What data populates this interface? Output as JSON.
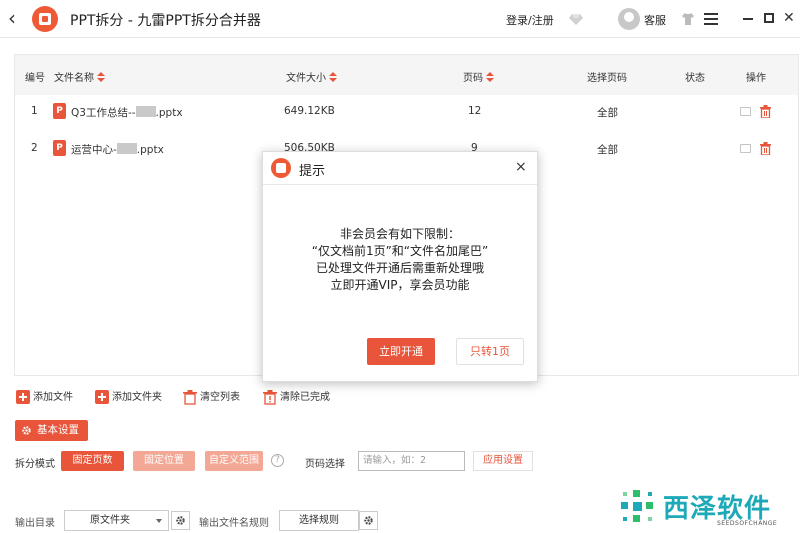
{
  "titlebar": {
    "title": "PPT拆分 - 九雷PPT拆分合并器",
    "login": "登录/注册",
    "service": "客服"
  },
  "table": {
    "headers": {
      "index": "编号",
      "name": "文件名称",
      "size": "文件大小",
      "pages": "页码",
      "select_pages": "选择页码",
      "status": "状态",
      "action": "操作"
    },
    "rows": [
      {
        "index": "1",
        "name_prefix": "Q3工作总结--",
        "name_suffix": ".pptx",
        "size": "649.12KB",
        "pages": "12",
        "select": "全部",
        "status": ""
      },
      {
        "index": "2",
        "name_prefix": "运营中心-",
        "name_suffix": ".pptx",
        "size": "506.50KB",
        "pages": "9",
        "select": "全部",
        "status": ""
      }
    ]
  },
  "actions": {
    "add_file": "添加文件",
    "add_folder": "添加文件夹",
    "clear_list": "清空列表",
    "clear_done": "清除已完成"
  },
  "settings": {
    "basic": "基本设置",
    "split_mode_label": "拆分模式",
    "modes": [
      "固定页数",
      "固定位置",
      "自定义范围"
    ],
    "help": "?",
    "page_select_label": "页码选择",
    "page_placeholder": "请输入，如：2",
    "apply": "应用设置"
  },
  "output": {
    "dir_label": "输出目录",
    "dir_value": "原文件夹",
    "rule_label": "输出文件名规则",
    "rule_button": "选择规则"
  },
  "watermark": {
    "text": "西泽软件",
    "sub": "SEEDSOFCHANGE"
  },
  "dialog": {
    "title": "提示",
    "close": "×",
    "lines": [
      "非会员会有如下限制：",
      "“仅文档前1页”和“文件名加尾巴”",
      "已处理文件开通后需重新处理哦",
      "立即开通VIP，享会员功能"
    ],
    "ok": "立即开通",
    "cancel": "只转1页"
  },
  "colors": {
    "accent": "#e8553a",
    "accent_light": "#f3a896",
    "watermark": "#1ea9b8"
  }
}
